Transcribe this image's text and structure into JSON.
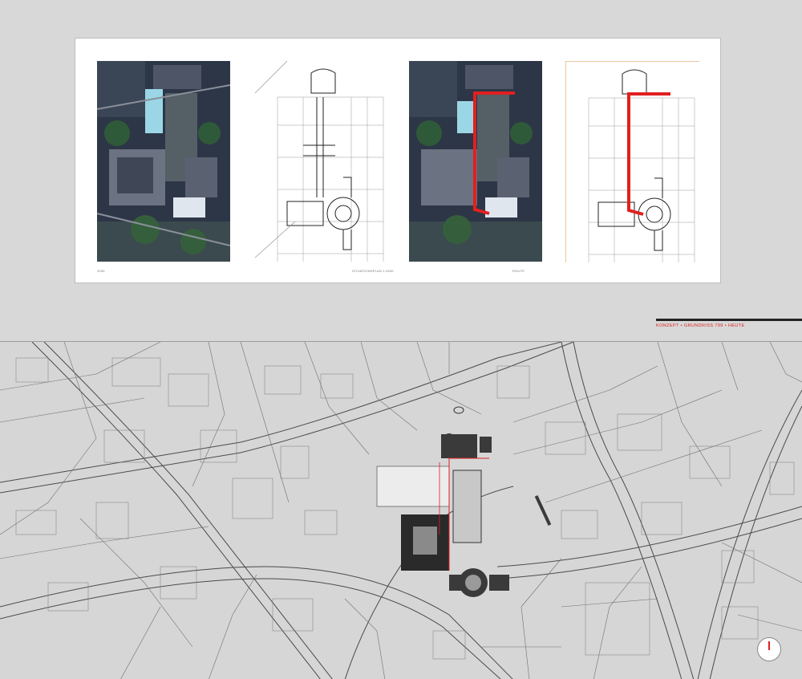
{
  "sheet": {
    "panels": [
      {
        "id": "aerial-photo",
        "caption": "2005"
      },
      {
        "id": "plan-drawing",
        "caption": "SITUATIONSPLAN 1:2500"
      },
      {
        "id": "aerial-route",
        "caption": "ROUTE"
      },
      {
        "id": "plan-route",
        "caption": ""
      }
    ]
  },
  "title": "KONZEPT • GRUNDRISS 799 • HEUTE",
  "colors": {
    "route": "#e02020",
    "map_background": "#d6d6d6",
    "map_lines": "#4a4a4a",
    "sheet_background": "#ffffff",
    "title_rule": "#222222"
  },
  "map": {
    "north_arrow": "north-arrow-icon"
  }
}
